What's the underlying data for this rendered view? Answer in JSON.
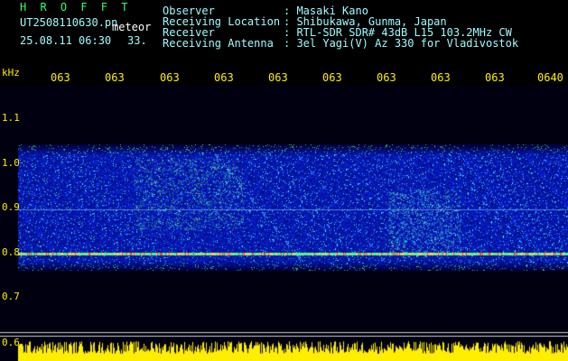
{
  "header": {
    "title": "H R O F F T",
    "file": "UT2508110630.pn",
    "mode": "meteor",
    "datetime": "25.08.11 06:30",
    "count": "33."
  },
  "info": [
    {
      "label": "Observer",
      "value": ": Masaki Kano"
    },
    {
      "label": "Receiving Location",
      "value": ": Shibukawa, Gunma, Japan"
    },
    {
      "label": "Receiver",
      "value": ": RTL-SDR SDR# 43dB L15 103.2MHz CW"
    },
    {
      "label": "Receiving Antenna",
      "value": ": 3el Yagi(V) Az 330 for Vladivostok"
    }
  ],
  "axis": {
    "unit": "kHz",
    "y_ticks": [
      "1.1",
      "1.0",
      "0.9",
      "0.8",
      "0.7",
      "0.6"
    ],
    "x_ticks": [
      "063",
      "063",
      "063",
      "063",
      "063",
      "063",
      "063",
      "063",
      "063",
      "0640"
    ]
  },
  "colors": {
    "background": "#000000",
    "title": "#33ff66",
    "info": "#9ffcff",
    "ticks": "#ffee00",
    "noise_floor": "#0a2aa0",
    "carrier": "#ff4020"
  }
}
